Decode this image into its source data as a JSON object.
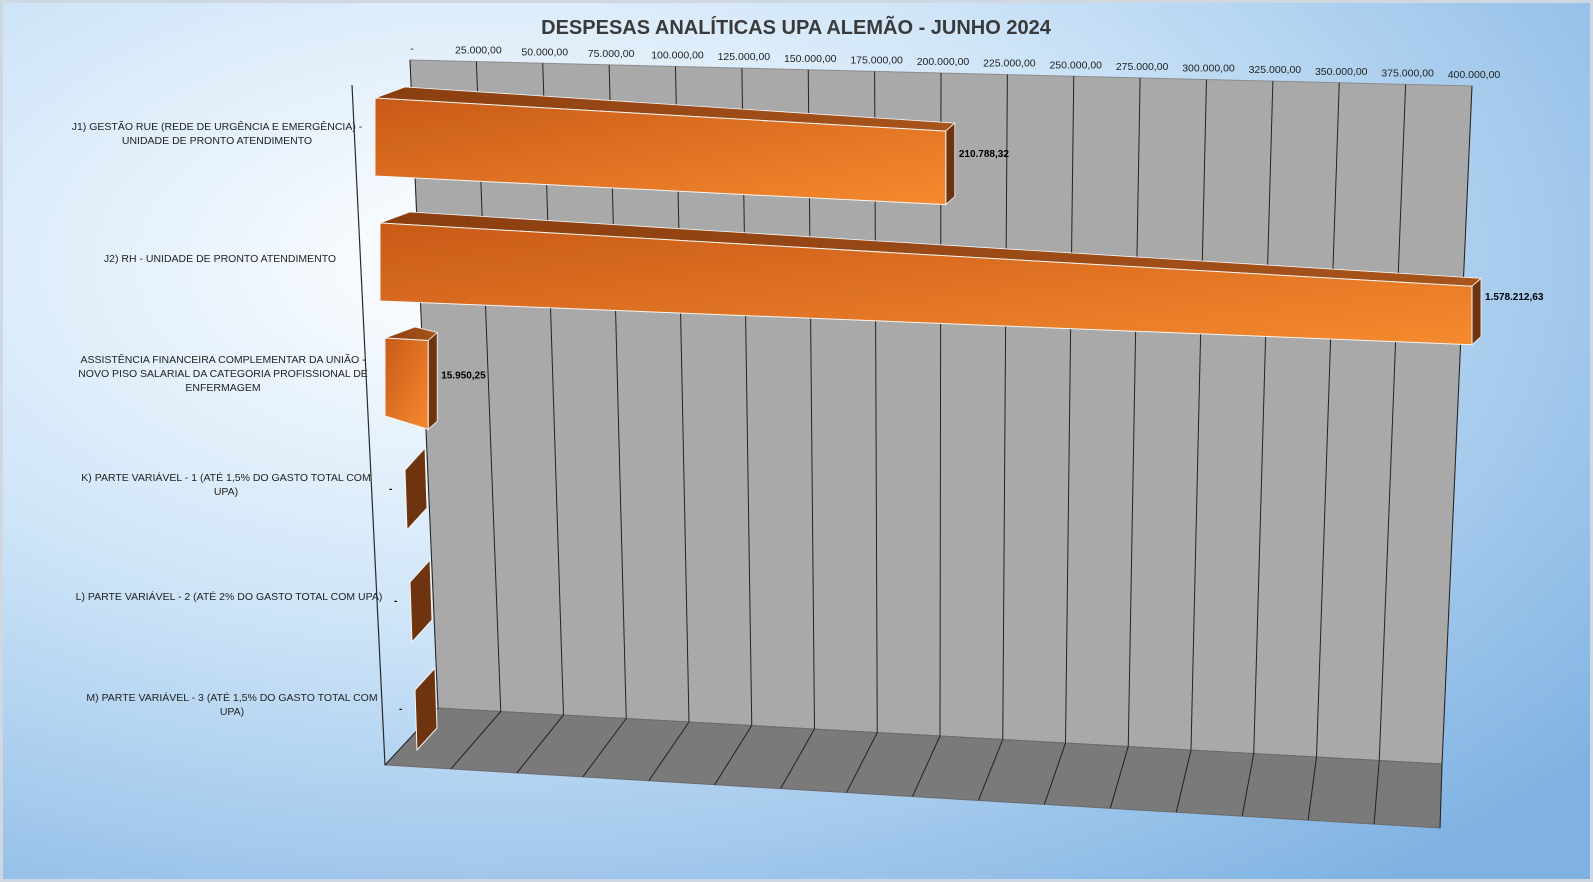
{
  "chart_data": {
    "type": "bar",
    "orientation": "horizontal",
    "style": "3d",
    "title": "DESPESAS ANALÍTICAS UPA ALEMÃO - JUNHO 2024",
    "xlabel": "",
    "ylabel": "",
    "xlim": [
      0,
      400000
    ],
    "x_ticks": [
      0,
      25000,
      50000,
      75000,
      100000,
      125000,
      150000,
      175000,
      200000,
      225000,
      250000,
      275000,
      300000,
      325000,
      350000,
      375000,
      400000
    ],
    "x_tick_labels": [
      "-",
      "25.000,00",
      "50.000,00",
      "75.000,00",
      "100.000,00",
      "125.000,00",
      "150.000,00",
      "175.000,00",
      "200.000,00",
      "225.000,00",
      "250.000,00",
      "275.000,00",
      "300.000,00",
      "325.000,00",
      "350.000,00",
      "375.000,00",
      "400.000,00"
    ],
    "grid": true,
    "legend": "none",
    "categories": [
      [
        "J1) GESTÃO RUE (REDE DE URGÊNCIA E EMERGÊNCIA) -",
        "UNIDADE DE PRONTO ATENDIMENTO"
      ],
      [
        "J2) RH - UNIDADE DE PRONTO ATENDIMENTO"
      ],
      [
        "ASSISTÊNCIA FINANCEIRA COMPLEMENTAR DA UNIÃO -",
        "NOVO PISO SALARIAL DA CATEGORIA PROFISSIONAL DE",
        "ENFERMAGEM"
      ],
      [
        "K) PARTE VARIÁVEL - 1 (ATÉ 1,5% DO GASTO TOTAL COM",
        "UPA)"
      ],
      [
        "L) PARTE VARIÁVEL - 2 (ATÉ 2%  DO GASTO TOTAL COM UPA)"
      ],
      [
        "M)  PARTE VARIÁVEL - 3 (ATÉ 1,5% DO GASTO TOTAL COM",
        "UPA)"
      ]
    ],
    "values": [
      210788.32,
      1578212.63,
      15950.25,
      0,
      0,
      0
    ],
    "data_labels": [
      "210.788,32",
      "1.578.212,63",
      "15.950,25",
      "-",
      "-",
      "-"
    ],
    "colors": {
      "bar_front": "#f07a2a",
      "bar_top": "#9a4a16",
      "bar_side": "#6e3410",
      "wall": "#a9a9a9",
      "floor": "#7a7a7a",
      "background": "#bcd8f2"
    }
  }
}
